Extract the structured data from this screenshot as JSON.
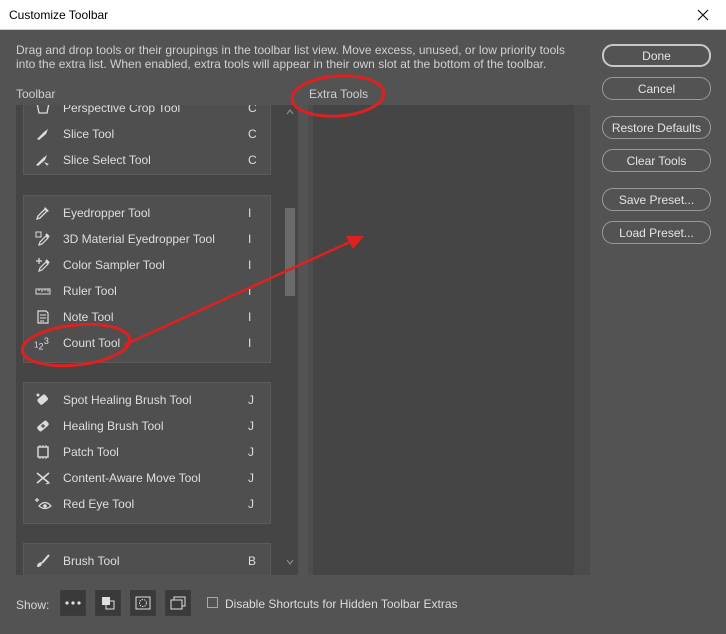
{
  "window": {
    "title": "Customize Toolbar"
  },
  "description": "Drag and drop tools or their groupings in the toolbar list view. Move excess, unused, or low priority tools into the extra list. When enabled, extra tools will appear in their own slot at the bottom of the toolbar.",
  "columns": {
    "toolbar_label": "Toolbar",
    "extra_label": "Extra Tools"
  },
  "groups": [
    {
      "tools": [
        {
          "name": "Perspective Crop Tool",
          "key": "C",
          "icon": "perspective-crop-icon"
        },
        {
          "name": "Slice Tool",
          "key": "C",
          "icon": "slice-icon"
        },
        {
          "name": "Slice Select Tool",
          "key": "C",
          "icon": "slice-select-icon"
        }
      ]
    },
    {
      "tools": [
        {
          "name": "Eyedropper Tool",
          "key": "I",
          "icon": "eyedropper-icon"
        },
        {
          "name": "3D Material Eyedropper Tool",
          "key": "I",
          "icon": "3d-eyedropper-icon"
        },
        {
          "name": "Color Sampler Tool",
          "key": "I",
          "icon": "color-sampler-icon"
        },
        {
          "name": "Ruler Tool",
          "key": "I",
          "icon": "ruler-icon"
        },
        {
          "name": "Note Tool",
          "key": "I",
          "icon": "note-icon"
        },
        {
          "name": "Count Tool",
          "key": "I",
          "icon": "count-icon"
        }
      ]
    },
    {
      "tools": [
        {
          "name": "Spot Healing Brush Tool",
          "key": "J",
          "icon": "spot-healing-icon"
        },
        {
          "name": "Healing Brush Tool",
          "key": "J",
          "icon": "healing-brush-icon"
        },
        {
          "name": "Patch Tool",
          "key": "J",
          "icon": "patch-icon"
        },
        {
          "name": "Content-Aware Move Tool",
          "key": "J",
          "icon": "content-aware-move-icon"
        },
        {
          "name": "Red Eye Tool",
          "key": "J",
          "icon": "red-eye-icon"
        }
      ]
    },
    {
      "tools": [
        {
          "name": "Brush Tool",
          "key": "B",
          "icon": "brush-icon"
        }
      ]
    }
  ],
  "buttons": {
    "done": "Done",
    "cancel": "Cancel",
    "restore": "Restore Defaults",
    "clear": "Clear Tools",
    "save": "Save Preset...",
    "load": "Load Preset..."
  },
  "footer": {
    "show_label": "Show:",
    "show_buttons": [
      "more-icon",
      "foreground-background-icon",
      "quick-mask-icon",
      "screen-mode-icon"
    ],
    "checkbox_label": "Disable Shortcuts for Hidden Toolbar Extras",
    "checkbox_checked": false
  },
  "colors": {
    "annotation": "#e02020",
    "panel": "#454545",
    "background": "#535353"
  }
}
